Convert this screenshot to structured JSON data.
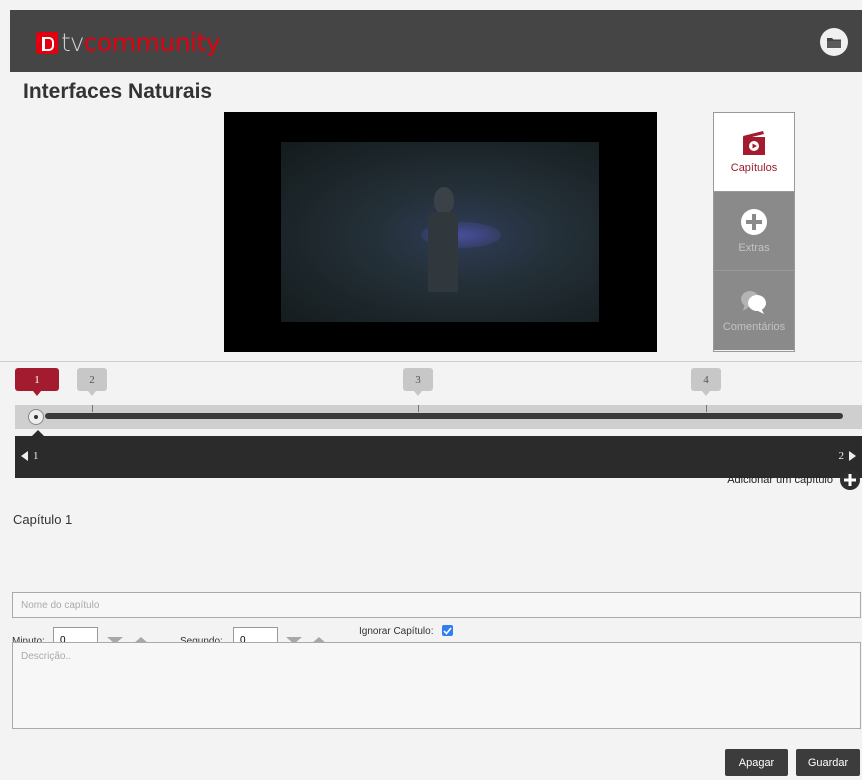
{
  "header": {
    "logo_tv": "tv",
    "logo_community": "community",
    "folder_icon": "folder-icon"
  },
  "colors": {
    "brand_red": "#e00010",
    "active_marker": "#a31b2e",
    "topbar_bg": "#454545"
  },
  "page": {
    "title": "Interfaces Naturais"
  },
  "side_panel": {
    "tabs": [
      {
        "label": "Capítulos",
        "icon": "chapters-icon",
        "active": true
      },
      {
        "label": "Extras",
        "icon": "plus-circle-icon",
        "active": false
      },
      {
        "label": "Comentários",
        "icon": "comments-icon",
        "active": false
      }
    ]
  },
  "timeline": {
    "markers": [
      {
        "label": "1",
        "active": true
      },
      {
        "label": "2",
        "active": false
      },
      {
        "label": "3",
        "active": false
      },
      {
        "label": "4",
        "active": false
      }
    ],
    "prev_label": "1",
    "next_label": "2"
  },
  "form": {
    "add_chapter_label": "Adicionar um capítulo",
    "chapter_heading": "Capítulo 1",
    "name_placeholder": "Nome do capítulo",
    "minute_label": "Minuto:",
    "minute_value": "0",
    "second_label": "Segundo:",
    "second_value": "0",
    "ignore_label": "Ignorar Capítulo:",
    "ignore_checked": true,
    "description_placeholder": "Descrição..",
    "delete_label": "Apagar",
    "save_label": "Guardar"
  }
}
